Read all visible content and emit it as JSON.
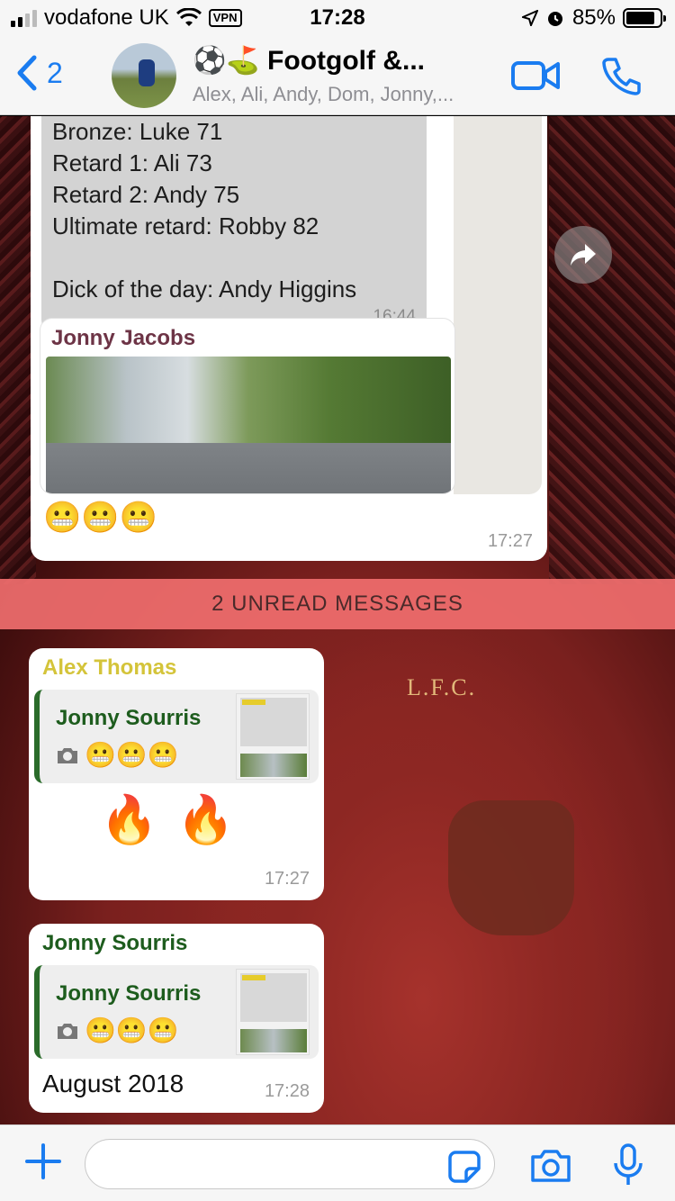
{
  "status_bar": {
    "carrier": "vodafone UK",
    "vpn": "VPN",
    "time": "17:28",
    "battery": "85%",
    "battery_level": 0.85
  },
  "header": {
    "back_count": "2",
    "title": "⚽️⛳️ Footgolf &...",
    "subtitle": "Alex, Ali, Andy, Dom, Jonny,..."
  },
  "messages": {
    "forwarded": {
      "lines": [
        "Bronze: Luke 71",
        "Retard 1: Ali 73",
        "Retard 2: Andy 75",
        "Ultimate retard: Robby 82"
      ],
      "last_line": "Dick of the day: Andy Higgins",
      "inner_time": "16:44",
      "photo_author": "Jonny Jacobs",
      "emoji": "😬😬😬",
      "time": "17:27"
    },
    "unread_banner": "2 UNREAD MESSAGES",
    "alex": {
      "sender": "Alex Thomas",
      "sender_color": "#d4c43a",
      "quote_name": "Jonny Sourris",
      "quote_emoji": "😬😬😬",
      "body": "🔥🔥",
      "time": "17:27"
    },
    "jonny": {
      "sender": "Jonny Sourris",
      "sender_color": "#1d5c1d",
      "quote_name": "Jonny Sourris",
      "quote_emoji": "😬😬😬",
      "body": "August 2018",
      "time": "17:28"
    }
  },
  "input": {
    "placeholder": ""
  },
  "background": {
    "shirt_text": "L.F.C."
  },
  "colors": {
    "accent": "#1a7cf0",
    "unread_banner": "#f06e6e"
  }
}
